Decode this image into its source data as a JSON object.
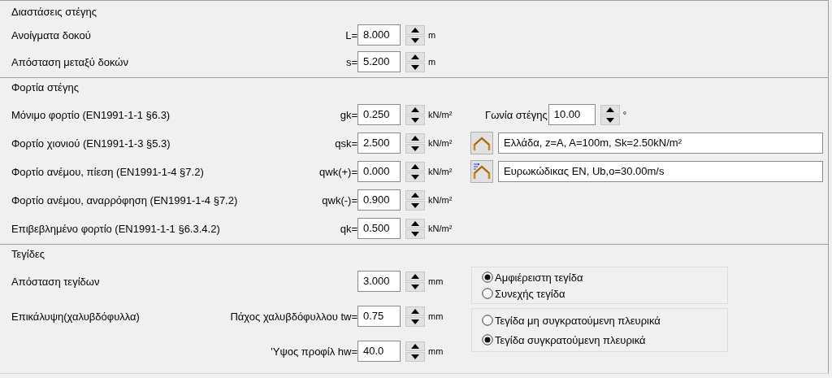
{
  "sections": [
    {
      "title": "Διαστάσεις στέγης",
      "rows": [
        {
          "label": "Ανοίγματα δοκού",
          "prefix": "L=",
          "value": "8.000",
          "unit": "m"
        },
        {
          "label": "Απόσταση μεταξύ δοκών",
          "prefix": "s=",
          "value": "5.200",
          "unit": "m"
        }
      ]
    },
    {
      "title": "Φορτία στέγης",
      "rows": [
        {
          "label": "Μόνιμο φορτίο (EN1991-1-1 §6.3)",
          "prefix": "gk=",
          "value": "0.250",
          "unit": "kN/m²",
          "extra": {
            "kind": "spin",
            "label": "Γωνία στέγης",
            "value": "10.00",
            "unit": "°"
          }
        },
        {
          "label": "Φορτίο χιονιού (EN1991-1-3 §5.3)",
          "prefix": "qsk=",
          "value": "2.500",
          "unit": "kN/m²",
          "extra": {
            "kind": "snow",
            "value": "Ελλάδα, z=A, A=100m, Sk=2.50kN/m²"
          }
        },
        {
          "label": "Φορτίο ανέμου, πίεση (EN1991-1-4 §7.2)",
          "prefix": "qwk(+)=",
          "value": "0.000",
          "unit": "kN/m²",
          "extra": {
            "kind": "wind",
            "value": "Ευρωκώδικας EN, Ub,o=30.00m/s"
          }
        },
        {
          "label": "Φορτίο ανέμου, αναρρόφηση (EN1991-1-4 §7.2)",
          "prefix": "qwk(-)=",
          "value": "0.900",
          "unit": "kN/m²"
        },
        {
          "label": "Επιβεβλημένο φορτίο (EN1991-1-1 §6.3.4.2)",
          "prefix": "qk=",
          "value": "0.500",
          "unit": "kN/m²"
        }
      ]
    },
    {
      "title": "Τεγίδες",
      "rows": [
        {
          "label": "Απόσταση τεγίδων",
          "value": "3.000",
          "unit": "mm"
        },
        {
          "label": "Επικάλυψη(χαλυβδόφυλλα)",
          "prefix": "Πάχος χαλυβδόφυλλου tw=",
          "value": "0.75",
          "unit": "mm"
        },
        {
          "prefix": "'Υψος προφίλ hw=",
          "value": "40.0",
          "unit": "mm"
        }
      ],
      "radio_groups": [
        {
          "options": [
            {
              "label": "Αμφιέρειστη τεγίδα",
              "selected": true
            },
            {
              "label": "Συνεχής τεγίδα",
              "selected": false
            }
          ]
        },
        {
          "options": [
            {
              "label": "Τεγίδα μη συγκρατούμενη πλευρικά",
              "selected": false
            },
            {
              "label": "Τεγίδα συγκρατούμενη πλευρικά",
              "selected": true
            }
          ]
        }
      ]
    }
  ]
}
